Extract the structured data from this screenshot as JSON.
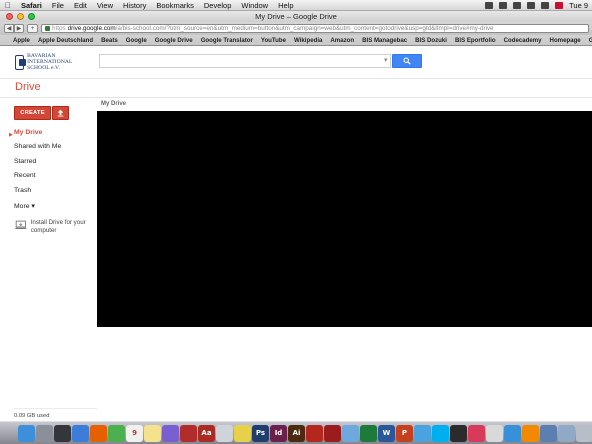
{
  "menubar": {
    "apple_icon": "apple-icon",
    "app_name": "Safari",
    "items": [
      "File",
      "Edit",
      "View",
      "History",
      "Bookmarks",
      "Develop",
      "Window",
      "Help"
    ],
    "clock": "Tue 9"
  },
  "window": {
    "title": "My Drive – Google Drive"
  },
  "toolbar": {
    "back_icon": "back-arrow-icon",
    "forward_icon": "forward-arrow-icon",
    "add_bookmark_label": "+",
    "protocol": "https",
    "host": "drive.google.com",
    "path": "/a/bis-school.com/?utm_source=en&utm_medium=button&utm_campaign=web&utm_content=gotodrive&usp=gtd&ltmpl=drive#my-drive"
  },
  "bookmarks": {
    "items": [
      "Apple",
      "Apple Deutschland",
      "Beats",
      "Google",
      "Google Drive",
      "Google Translator",
      "YouTube",
      "Wikipedia",
      "Amazon",
      "BIS Managebac",
      "BIS Dozuki",
      "BIS Eportfolio",
      "Codecademy",
      "Homepage",
      "Gu"
    ]
  },
  "header": {
    "logo_text": "BAVARIAN INTERNATIONAL SCHOOL e.V.",
    "search_value": "",
    "search_icon": "search-icon"
  },
  "drive": {
    "title": "Drive",
    "create_label": "CREATE",
    "upload_icon": "upload-icon",
    "nav": [
      {
        "label": "My Drive",
        "active": true
      },
      {
        "label": "Shared with Me",
        "active": false
      },
      {
        "label": "Starred",
        "active": false
      },
      {
        "label": "Recent",
        "active": false
      },
      {
        "label": "Trash",
        "active": false
      },
      {
        "label": "More ▾",
        "active": false
      }
    ],
    "install_label": "Install Drive for your computer",
    "storage_used": "0.09 GB used",
    "breadcrumb": "My Drive"
  },
  "dock": {
    "icons": [
      {
        "name": "finder-icon",
        "color": "#3d8fd9"
      },
      {
        "name": "launchpad-icon",
        "color": "#8a8f99"
      },
      {
        "name": "mission-control-icon",
        "color": "#34363b"
      },
      {
        "name": "safari-icon",
        "color": "#3b7dd8"
      },
      {
        "name": "firefox-icon",
        "color": "#e66000"
      },
      {
        "name": "chrome-icon",
        "color": "#4caf50"
      },
      {
        "name": "calendar-icon",
        "color": "#f0f0f0",
        "text": "9"
      },
      {
        "name": "notes-icon",
        "color": "#f5e28c"
      },
      {
        "name": "itunes-icon",
        "color": "#7a5fd1"
      },
      {
        "name": "photo-booth-icon",
        "color": "#b32c2c"
      },
      {
        "name": "dictionary-icon",
        "color": "#a92b24",
        "text": "Aa"
      },
      {
        "name": "preview-icon",
        "color": "#cfd4da"
      },
      {
        "name": "stickies-icon",
        "color": "#e8d14a"
      },
      {
        "name": "photoshop-icon",
        "color": "#1f3e6e",
        "text": "Ps"
      },
      {
        "name": "indesign-icon",
        "color": "#6b1f4c",
        "text": "Id"
      },
      {
        "name": "illustrator-icon",
        "color": "#4b2a10",
        "text": "Ai"
      },
      {
        "name": "acrobat-icon",
        "color": "#b3271c"
      },
      {
        "name": "flash-icon",
        "color": "#9b1c1c"
      },
      {
        "name": "photos-icon",
        "color": "#6fa8dc"
      },
      {
        "name": "excel-icon",
        "color": "#1e7a3a"
      },
      {
        "name": "word-icon",
        "color": "#2b579a",
        "text": "W"
      },
      {
        "name": "powerpoint-icon",
        "color": "#c4401e",
        "text": "P"
      },
      {
        "name": "twitter-icon",
        "color": "#4aa3df"
      },
      {
        "name": "skype-icon",
        "color": "#00aff0"
      },
      {
        "name": "terminal-icon",
        "color": "#2b2b2b"
      },
      {
        "name": "itunes-store-icon",
        "color": "#d83b5a"
      },
      {
        "name": "game-center-icon",
        "color": "#d9d9d9"
      },
      {
        "name": "app-store-icon",
        "color": "#3a8fd9"
      },
      {
        "name": "vlc-icon",
        "color": "#f18a00"
      },
      {
        "name": "downloads-icon",
        "color": "#5a7fb0"
      },
      {
        "name": "documents-icon",
        "color": "#8fa9c7"
      },
      {
        "name": "trash-icon",
        "color": "#b8bec6"
      }
    ]
  },
  "colors": {
    "drive_red": "#dd4b39",
    "button_red": "#d14836",
    "search_blue": "#4285f4",
    "content_black": "#000000"
  }
}
